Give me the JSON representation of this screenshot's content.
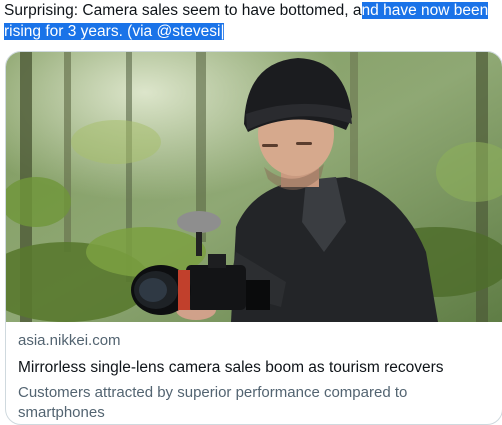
{
  "tweet": {
    "text_plain": "Surprising: Camera sales seem to have bottomed, a",
    "text_selected_1": "nd have now been",
    "text_selected_2": "rising for 3 years. (via @stevesi",
    "text_selected_3": "|"
  },
  "card": {
    "domain": "asia.nikkei.com",
    "title": "Mirrorless single-lens camera sales boom as tourism recovers",
    "description": "Customers attracted by superior performance compared to smartphones",
    "image_alt": "Man in black beanie holding a mirrorless camera with a microphone in a forest"
  },
  "colors": {
    "selection": "#1a73e8",
    "secondary_text": "#536471",
    "border": "#cfd9de"
  }
}
